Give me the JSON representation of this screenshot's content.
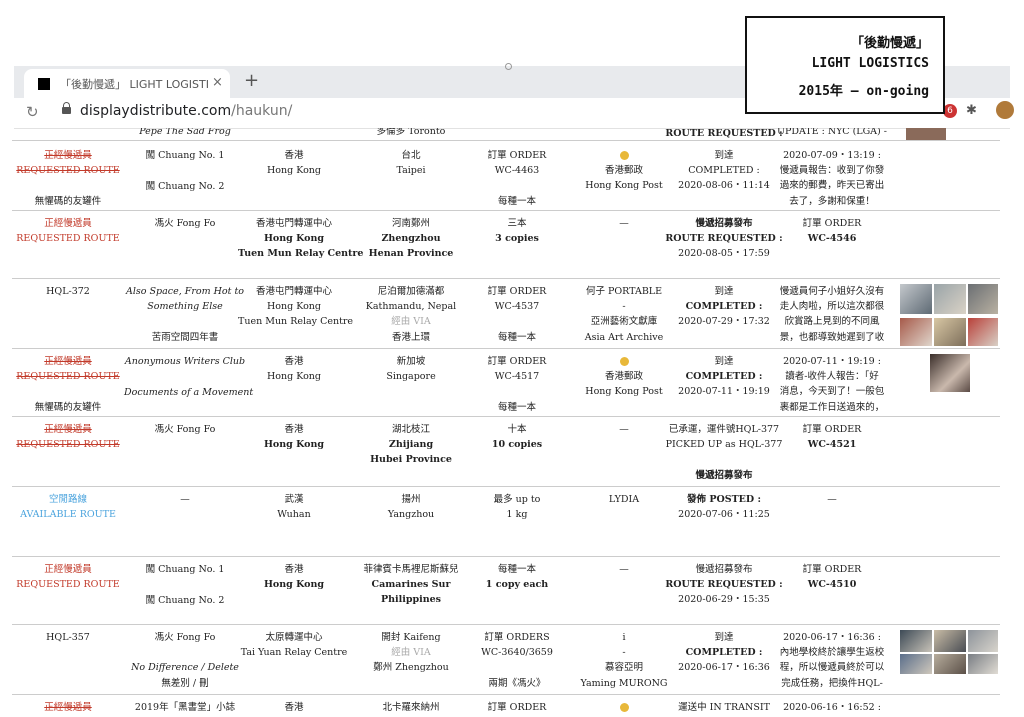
{
  "overlay": {
    "line1": "「後勤慢遞」",
    "line2": "LIGHT LOGISTICS",
    "line3": "2015年 — on-going"
  },
  "browser": {
    "tab_title": "「後勤慢遞」 LIGHT LOGISTIC",
    "url_host": "displaydistribute.com",
    "url_path": "/haukun/",
    "ext_badge": "6"
  },
  "rows": {
    "r0": {
      "c1": "Pepe The Sad Frog",
      "c3": "多倫多 Toronto",
      "c6": "ROUTE REQUESTED :",
      "c7": "UPDATE : NYC (LGA) -"
    },
    "r1": {
      "c0a": "正經慢遞員",
      "c0b": "REQUESTED ROUTE",
      "c0c": "無懼碼的友罐件",
      "c1a": "闖 Chuang No. 1",
      "c1b": "闖 Chuang No. 2",
      "c2a": "香港",
      "c2b": "Hong Kong",
      "c3a": "台北",
      "c3b": "Taipei",
      "c4a": "訂單 ORDER",
      "c4b": "WC-4463",
      "c4c": "每種一本",
      "c5b": "香港郵政",
      "c5c": "Hong Kong Post",
      "c6a": "到達",
      "c6b": "COMPLETED :",
      "c6c": "2020-08-06・11:14",
      "c7a": "2020-07-09・13:19 :",
      "c7b": "慢遞員報告：收到了你發",
      "c7c": "過來的郵費，昨天已寄出",
      "c7d": "去了，多謝和保重！"
    },
    "r2": {
      "c0a": "正經慢遞員",
      "c0b": "REQUESTED ROUTE",
      "c1a": "馮火 Fong Fo",
      "c2a": "香港屯門轉運中心",
      "c2b": "Hong Kong",
      "c2c": "Tuen Mun Relay Centre",
      "c3a": "河南鄭州",
      "c3b": "Zhengzhou",
      "c3c": "Henan Province",
      "c4a": "三本",
      "c4b": "3 copies",
      "c5a": "—",
      "c6a": "慢遞招募發布",
      "c6b": "ROUTE REQUESTED :",
      "c6c": "2020-08-05・17:59",
      "c7a": "訂單 ORDER",
      "c7b": "WC-4546"
    },
    "r3": {
      "c0a": "HQL-372",
      "c1a": "Also Space, From Hot to",
      "c1b": "Something Else",
      "c1c": "苦雨空間四年書",
      "c2a": "香港屯門轉運中心",
      "c2b": "Hong Kong",
      "c2c": "Tuen Mun Relay Centre",
      "c3a": "尼泊爾加德滿都",
      "c3b": "Kathmandu, Nepal",
      "c3c": "經由 VIA",
      "c3d": "香港上環",
      "c4a": "訂單 ORDER",
      "c4b": "WC-4537",
      "c4c": "每種一本",
      "c5a": "何子 PORTABLE",
      "c5b": "-",
      "c5c": "亞洲藝術文獻庫",
      "c5d": "Asia Art Archive",
      "c6a": "到達",
      "c6b": "COMPLETED :",
      "c6c": "2020-07-29・17:32",
      "c7a": "慢遞員何子小姐好久沒有",
      "c7b": "走人肉啦，所以這次都很",
      "c7c": "欣賞路上見到的不同風",
      "c7d": "景，也都導致她遲到了收"
    },
    "r4": {
      "c0a": "正經慢遞員",
      "c0b": "REQUESTED ROUTE",
      "c0c": "無懼碼的友罐件",
      "c1a": "Anonymous Writers Club",
      "c1b": "Documents of a Movement",
      "c2a": "香港",
      "c2b": "Hong Kong",
      "c3a": "新加坡",
      "c3b": "Singapore",
      "c4a": "訂單 ORDER",
      "c4b": "WC-4517",
      "c4c": "每種一本",
      "c5b": "香港郵政",
      "c5c": "Hong Kong Post",
      "c6a": "到達",
      "c6b": "COMPLETED :",
      "c6c": "2020-07-11・19:19",
      "c7a": "2020-07-11・19:19 :",
      "c7b": "讀者-收件人報告：「好",
      "c7c": "消息，今天到了！一般包",
      "c7d": "裹都是工作日送過來的，"
    },
    "r5": {
      "c0a": "正經慢遞員",
      "c0b": "REQUESTED ROUTE",
      "c1a": "馮火 Fong Fo",
      "c2a": "香港",
      "c2b": "Hong Kong",
      "c3a": "湖北枝江",
      "c3b": "Zhijiang",
      "c3c": "Hubei Province",
      "c4a": "十本",
      "c4b": "10 copies",
      "c5a": "—",
      "c6a": "已承運，運件號HQL-377",
      "c6b": "PICKED UP as HQL-377",
      "c6c": "慢遞招募發布",
      "c7a": "訂單 ORDER",
      "c7b": "WC-4521"
    },
    "r6": {
      "c0a": "空閒路線",
      "c0b": "AVAILABLE ROUTE",
      "c1a": "—",
      "c2a": "武漢",
      "c2b": "Wuhan",
      "c3a": "揚州",
      "c3b": "Yangzhou",
      "c4a": "最多 up to",
      "c4b": "1 kg",
      "c5a": "LYDIA",
      "c6a": "發佈 POSTED :",
      "c6b": "2020-07-06・11:25",
      "c7a": "—"
    },
    "r7": {
      "c0a": "正經慢遞員",
      "c0b": "REQUESTED ROUTE",
      "c1a": "闖 Chuang No. 1",
      "c1b": "闖 Chuang No. 2",
      "c2a": "香港",
      "c2b": "Hong Kong",
      "c3a": "菲律賓卡馬裡尼斯蘇兒",
      "c3b": "Camarines Sur",
      "c3c": "Philippines",
      "c4a": "每種一本",
      "c4b": "1 copy each",
      "c5a": "—",
      "c6a": "慢遞招募發布",
      "c6b": "ROUTE REQUESTED :",
      "c6c": "2020-06-29・15:35",
      "c7a": "訂單 ORDER",
      "c7b": "WC-4510"
    },
    "r8": {
      "c0a": "HQL-357",
      "c1a": "馮火 Fong Fo",
      "c1b": "No Difference / Delete",
      "c1c": "無差別 / 刪",
      "c2a": "太原轉運中心",
      "c2b": "Tai Yuan Relay Centre",
      "c3a": "開封 Kaifeng",
      "c3b": "經由 VIA",
      "c3c": "鄭州 Zhengzhou",
      "c4a": "訂單 ORDERS",
      "c4b": "WC-3640/3659",
      "c4c": "兩期《馮火》",
      "c5a": "i",
      "c5b": "-",
      "c5c": "慕容亞明",
      "c5d": "Yaming MURONG",
      "c6a": "到達",
      "c6b": "COMPLETED :",
      "c6c": "2020-06-17・16:36",
      "c7a": "2020-06-17・16:36 :",
      "c7b": "內地學校終於讓學生返校",
      "c7c": "程，所以慢遞員終於可以",
      "c7d": "完成任務，把換件HQL-"
    },
    "r9": {
      "c0a": "正經慢遞員",
      "c1a": "2019年「黑書堂」小誌",
      "c2a": "香港",
      "c3a": "北卡羅來納州",
      "c4a": "訂單 ORDER",
      "c6a": "運送中 IN TRANSIT",
      "c7a": "2020-06-16・16:52 :"
    }
  }
}
